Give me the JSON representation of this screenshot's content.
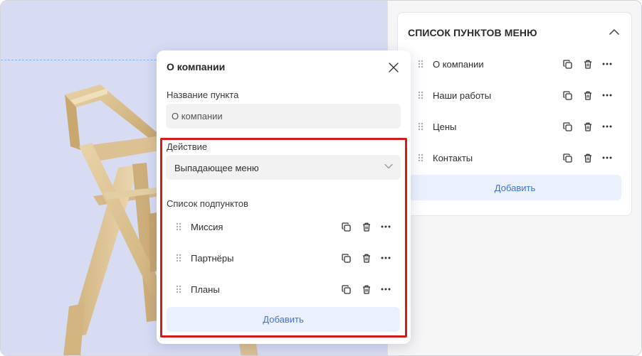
{
  "preview": {
    "image_name": "wooden-chair-model"
  },
  "menu_panel": {
    "title": "СПИСОК ПУНКТОВ МЕНЮ",
    "collapse_icon": "chevron-up-icon",
    "items": [
      {
        "label": "О компании"
      },
      {
        "label": "Наши работы"
      },
      {
        "label": "Цены"
      },
      {
        "label": "Контакты"
      }
    ],
    "add_label": "Добавить"
  },
  "popup": {
    "title": "О компании",
    "close_icon": "close-icon",
    "name_label": "Название пункта",
    "name_value": "О компании",
    "action_label": "Действие",
    "action_value": "Выпадающее меню",
    "subitems_label": "Список подпунктов",
    "subitems": [
      {
        "label": "Миссия"
      },
      {
        "label": "Партнёры"
      },
      {
        "label": "Планы"
      }
    ],
    "add_label": "Добавить"
  },
  "colors": {
    "accent": "#3e74d6",
    "add_button_bg": "#eaf1fc",
    "highlight": "#d41b1b",
    "preview_bg": "#d7dcf3"
  }
}
